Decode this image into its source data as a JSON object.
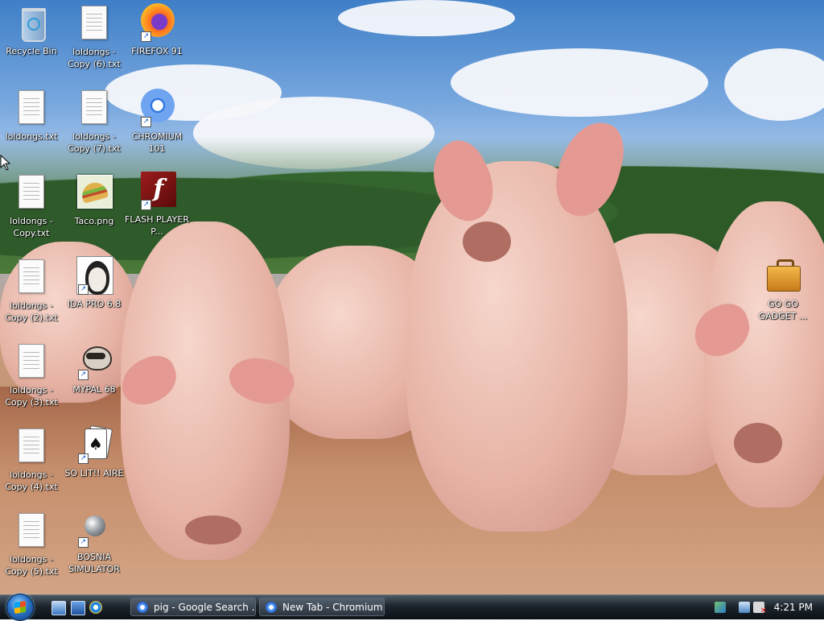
{
  "desktop_icons": [
    {
      "label": "Recycle Bin",
      "icon": "recycle-bin-icon"
    },
    {
      "label": "loldongs - Copy (6).txt",
      "icon": "text-file-icon"
    },
    {
      "label": "FIREFOX 91",
      "icon": "firefox-icon"
    },
    {
      "label": "loldongs.txt",
      "icon": "text-file-icon"
    },
    {
      "label": "loldongs - Copy (7).txt",
      "icon": "text-file-icon"
    },
    {
      "label": "CHROMIUM 101",
      "icon": "chromium-icon"
    },
    {
      "label": "loldongs - Copy.txt",
      "icon": "text-file-icon"
    },
    {
      "label": "Taco.png",
      "icon": "taco-image-icon"
    },
    {
      "label": "FLASH PLAYER P...",
      "icon": "flash-player-icon"
    },
    {
      "label": "loldongs - Copy (2).txt",
      "icon": "text-file-icon"
    },
    {
      "label": "IDA PRO 6.8",
      "icon": "ida-pro-icon"
    },
    {
      "label": "loldongs - Copy (3).txt",
      "icon": "text-file-icon"
    },
    {
      "label": "MYPAL 68",
      "icon": "mypal-icon"
    },
    {
      "label": "loldongs - Copy (4).txt",
      "icon": "text-file-icon"
    },
    {
      "label": "SO LIT!! AIRE",
      "icon": "solitaire-icon"
    },
    {
      "label": "loldongs - Copy (5).txt",
      "icon": "text-file-icon"
    },
    {
      "label": "BOSNIA SIMULATOR",
      "icon": "spiked-mine-icon"
    },
    {
      "label": "GO GO GADGET ...",
      "icon": "briefcase-icon"
    }
  ],
  "taskbar": {
    "tasks": [
      {
        "label": "pig - Google Search ..."
      },
      {
        "label": "New Tab - Chromium"
      }
    ],
    "clock": "4:21 PM"
  }
}
